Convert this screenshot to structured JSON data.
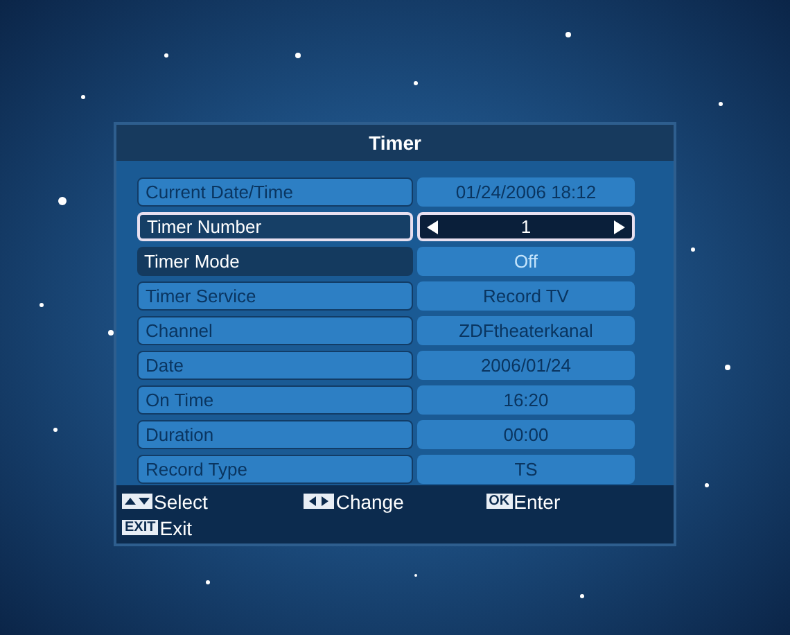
{
  "dialog": {
    "title": "Timer"
  },
  "rows": [
    {
      "label": "Current Date/Time",
      "value": "01/24/2006 18:12",
      "selected": false,
      "disabled": true
    },
    {
      "label": "Timer Number",
      "value": "1",
      "selected": true,
      "disabled": false
    },
    {
      "label": "Timer Mode",
      "value": "Off",
      "selected": false,
      "disabled": false
    },
    {
      "label": "Timer Service",
      "value": "Record TV",
      "selected": false,
      "disabled": true
    },
    {
      "label": "Channel",
      "value": "ZDFtheaterkanal",
      "selected": false,
      "disabled": true
    },
    {
      "label": "Date",
      "value": "2006/01/24",
      "selected": false,
      "disabled": true
    },
    {
      "label": "On Time",
      "value": "16:20",
      "selected": false,
      "disabled": true
    },
    {
      "label": "Duration",
      "value": "00:00",
      "selected": false,
      "disabled": true
    },
    {
      "label": "Record Type",
      "value": "TS",
      "selected": false,
      "disabled": true
    }
  ],
  "hints": [
    {
      "kind": "updown",
      "label": "Select"
    },
    {
      "kind": "leftright",
      "label": "Change"
    },
    {
      "kind": "key",
      "key": "OK",
      "label": "Enter"
    },
    {
      "kind": "key",
      "key": "EXIT",
      "label": "Exit"
    }
  ]
}
